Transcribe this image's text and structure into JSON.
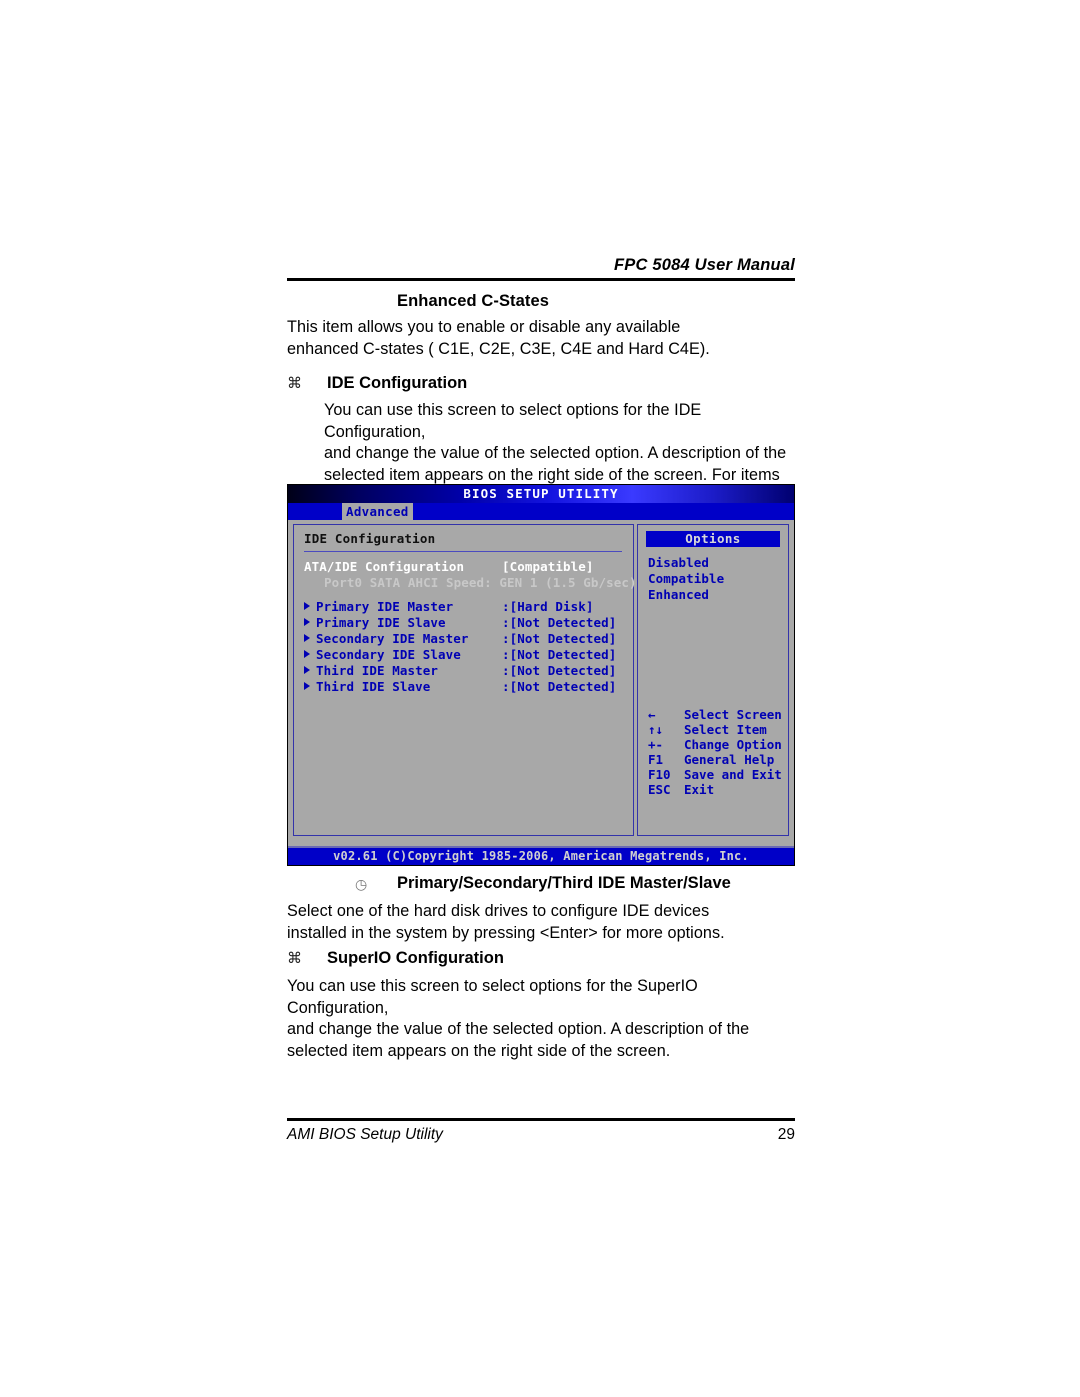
{
  "header": {
    "manual_title": "FPC 5084 User Manual"
  },
  "sections": {
    "enhanced_cstates": {
      "heading": "Enhanced C-States",
      "body": "This item allows you to enable or disable any available\nenhanced C-states ( C1E, C2E, C3E, C4E and Hard C4E)."
    },
    "ide_configuration": {
      "bullet": "⌘",
      "heading": "IDE Configuration",
      "body": "You can use this screen to select options for the IDE Configuration,\nand change the value of the selected option. A description of the\nselected item appears on the right side of the screen. For items\nmarked with “f”, please press <Enter> for more options."
    },
    "primary_secondary_third": {
      "bullet": "◷",
      "heading": "Primary/Secondary/Third IDE Master/Slave",
      "body": "Select one of the hard disk drives to configure IDE devices\ninstalled in the system by pressing <Enter> for more options."
    },
    "superio_configuration": {
      "bullet": "⌘",
      "heading": "SuperIO Configuration",
      "body": "You can use this screen to select options for the SuperIO Configuration,\nand change the value of the selected option. A description of the\nselected item appears on the right side of the screen."
    }
  },
  "bios": {
    "title": "BIOS SETUP UTILITY",
    "active_tab": "Advanced",
    "panel_title": "IDE Configuration",
    "rows": [
      {
        "label": "ATA/IDE Configuration",
        "value": "[Compatible]",
        "style": "selected"
      },
      {
        "label": "Port0 SATA AHCI Speed: GEN 1 (1.5 Gb/sec)",
        "value": "",
        "style": "dim"
      }
    ],
    "items": [
      {
        "label": "Primary IDE Master",
        "value": ":[Hard Disk]"
      },
      {
        "label": "Primary IDE Slave",
        "value": ":[Not Detected]"
      },
      {
        "label": "Secondary IDE Master",
        "value": ":[Not Detected]"
      },
      {
        "label": "Secondary IDE Slave",
        "value": ":[Not Detected]"
      },
      {
        "label": "Third IDE Master",
        "value": ":[Not Detected]"
      },
      {
        "label": "Third IDE Slave",
        "value": ":[Not Detected]"
      }
    ],
    "options": {
      "heading": "Options",
      "values": [
        "Disabled",
        "Compatible",
        "Enhanced"
      ]
    },
    "nav": [
      {
        "key": "←",
        "desc": "Select Screen"
      },
      {
        "key": "↑↓",
        "desc": "Select Item"
      },
      {
        "key": "+-",
        "desc": "Change Option"
      },
      {
        "key": "F1",
        "desc": "General Help"
      },
      {
        "key": "F10",
        "desc": "Save and Exit"
      },
      {
        "key": "ESC",
        "desc": "Exit"
      }
    ],
    "copyright": "v02.61 (C)Copyright 1985-2006, American Megatrends, Inc."
  },
  "footer": {
    "left": "AMI BIOS Setup Utility",
    "page_number": "29"
  },
  "colors": {
    "bios_blue": "#0000c8",
    "bios_grey": "#a8a8a8",
    "item_blue": "#0000b4"
  }
}
